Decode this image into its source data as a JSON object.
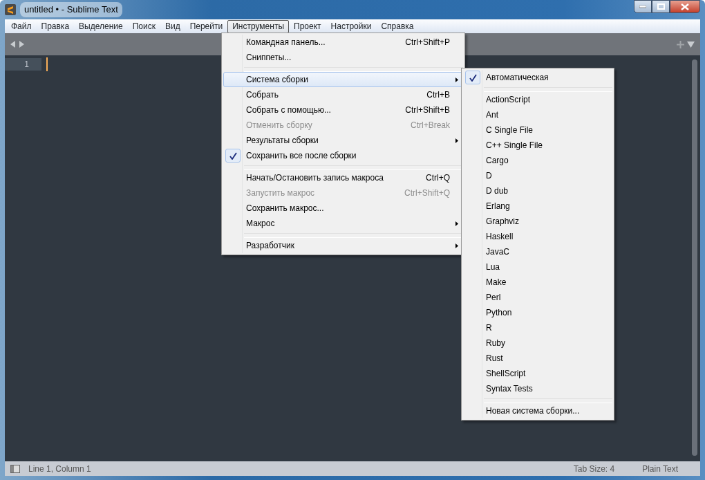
{
  "window": {
    "title": "untitled • - Sublime Text"
  },
  "menubar": [
    {
      "label": "Файл",
      "selected": false
    },
    {
      "label": "Правка",
      "selected": false
    },
    {
      "label": "Выделение",
      "selected": false
    },
    {
      "label": "Поиск",
      "selected": false
    },
    {
      "label": "Вид",
      "selected": false
    },
    {
      "label": "Перейти",
      "selected": false
    },
    {
      "label": "Инструменты",
      "selected": true
    },
    {
      "label": "Проект",
      "selected": false
    },
    {
      "label": "Настройки",
      "selected": false
    },
    {
      "label": "Справка",
      "selected": false
    }
  ],
  "editor": {
    "line_numbers": [
      "1"
    ]
  },
  "tools_menu": [
    {
      "kind": "item",
      "label": "Командная панель...",
      "shortcut": "Ctrl+Shift+P",
      "disabled": false,
      "checked": false,
      "submenu": false,
      "selected": false
    },
    {
      "kind": "item",
      "label": "Сниппеты...",
      "disabled": false,
      "checked": false,
      "submenu": false,
      "selected": false
    },
    {
      "kind": "separator"
    },
    {
      "kind": "item",
      "label": "Система сборки",
      "disabled": false,
      "checked": false,
      "submenu": true,
      "selected": true
    },
    {
      "kind": "item",
      "label": "Собрать",
      "shortcut": "Ctrl+B",
      "disabled": false,
      "checked": false,
      "submenu": false,
      "selected": false
    },
    {
      "kind": "item",
      "label": "Собрать с помощью...",
      "shortcut": "Ctrl+Shift+B",
      "disabled": false,
      "checked": false,
      "submenu": false,
      "selected": false
    },
    {
      "kind": "item",
      "label": "Отменить сборку",
      "shortcut": "Ctrl+Break",
      "disabled": true,
      "checked": false,
      "submenu": false,
      "selected": false
    },
    {
      "kind": "item",
      "label": "Результаты сборки",
      "disabled": false,
      "checked": false,
      "submenu": true,
      "selected": false
    },
    {
      "kind": "item",
      "label": "Сохранить все после сборки",
      "disabled": false,
      "checked": true,
      "submenu": false,
      "selected": false
    },
    {
      "kind": "separator"
    },
    {
      "kind": "item",
      "label": "Начать/Остановить запись макроса",
      "shortcut": "Ctrl+Q",
      "disabled": false,
      "checked": false,
      "submenu": false,
      "selected": false
    },
    {
      "kind": "item",
      "label": "Запустить макрос",
      "shortcut": "Ctrl+Shift+Q",
      "disabled": true,
      "checked": false,
      "submenu": false,
      "selected": false
    },
    {
      "kind": "item",
      "label": "Сохранить макрос...",
      "disabled": false,
      "checked": false,
      "submenu": false,
      "selected": false
    },
    {
      "kind": "item",
      "label": "Макрос",
      "disabled": false,
      "checked": false,
      "submenu": true,
      "selected": false
    },
    {
      "kind": "separator"
    },
    {
      "kind": "item",
      "label": "Разработчик",
      "disabled": false,
      "checked": false,
      "submenu": true,
      "selected": false
    }
  ],
  "build_system_menu": [
    {
      "kind": "item",
      "label": "Автоматическая",
      "checked": true
    },
    {
      "kind": "separator"
    },
    {
      "kind": "item",
      "label": "ActionScript",
      "checked": false
    },
    {
      "kind": "item",
      "label": "Ant",
      "checked": false
    },
    {
      "kind": "item",
      "label": "C Single File",
      "checked": false
    },
    {
      "kind": "item",
      "label": "C++ Single File",
      "checked": false
    },
    {
      "kind": "item",
      "label": "Cargo",
      "checked": false
    },
    {
      "kind": "item",
      "label": "D",
      "checked": false
    },
    {
      "kind": "item",
      "label": "D dub",
      "checked": false
    },
    {
      "kind": "item",
      "label": "Erlang",
      "checked": false
    },
    {
      "kind": "item",
      "label": "Graphviz",
      "checked": false
    },
    {
      "kind": "item",
      "label": "Haskell",
      "checked": false
    },
    {
      "kind": "item",
      "label": "JavaC",
      "checked": false
    },
    {
      "kind": "item",
      "label": "Lua",
      "checked": false
    },
    {
      "kind": "item",
      "label": "Make",
      "checked": false
    },
    {
      "kind": "item",
      "label": "Perl",
      "checked": false
    },
    {
      "kind": "item",
      "label": "Python",
      "checked": false
    },
    {
      "kind": "item",
      "label": "R",
      "checked": false
    },
    {
      "kind": "item",
      "label": "Ruby",
      "checked": false
    },
    {
      "kind": "item",
      "label": "Rust",
      "checked": false
    },
    {
      "kind": "item",
      "label": "ShellScript",
      "checked": false
    },
    {
      "kind": "item",
      "label": "Syntax Tests",
      "checked": false
    },
    {
      "kind": "separator"
    },
    {
      "kind": "item",
      "label": "Новая система сборки...",
      "checked": false
    }
  ],
  "status_bar": {
    "position": "Line 1, Column 1",
    "tab_size": "Tab Size: 4",
    "syntax": "Plain Text"
  }
}
